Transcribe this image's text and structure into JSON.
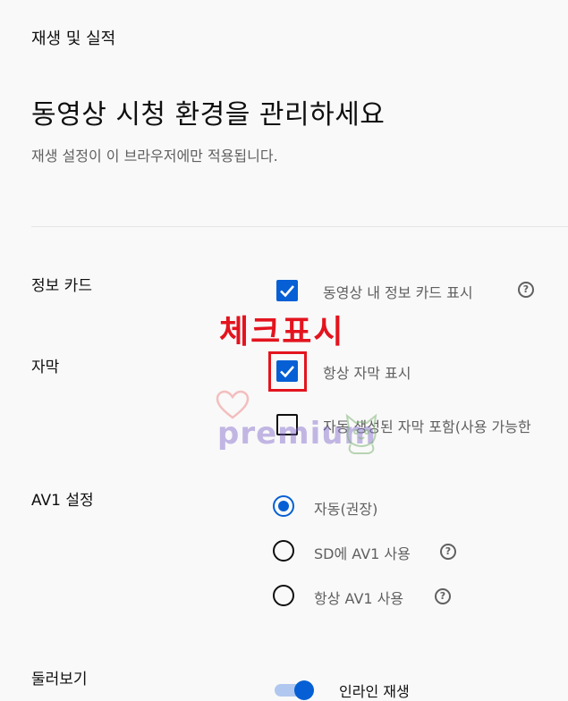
{
  "header": {
    "breadcrumb": "재생 및 실적",
    "title": "동영상 시청 환경을 관리하세요",
    "subtitle": "재생 설정이 이 브라우저에만 적용됩니다."
  },
  "sections": {
    "info_cards": {
      "label": "정보 카드",
      "option_label": "동영상 내 정보 카드 표시",
      "checked": true
    },
    "subtitles": {
      "label": "자막",
      "always_show_label": "항상 자막 표시",
      "always_show_checked": true,
      "auto_generated_label": "자동 생성된 자막 포함(사용 가능한",
      "auto_generated_checked": false
    },
    "av1": {
      "label": "AV1 설정",
      "options": [
        {
          "label": "자동(권장)",
          "selected": true
        },
        {
          "label": "SD에 AV1 사용",
          "selected": false
        },
        {
          "label": "항상 AV1 사용",
          "selected": false
        }
      ]
    },
    "browse": {
      "label": "둘러보기",
      "inline_play_label": "인라인 재생",
      "inline_play_on": true
    }
  },
  "annotation": {
    "text": "체크표시",
    "color": "#e3141e"
  },
  "watermark": {
    "text": "premium"
  },
  "colors": {
    "accent": "#065fd4",
    "secondary_text": "#606060"
  },
  "icons": {
    "help": "help-circle-icon",
    "check": "checkmark-icon",
    "heart": "heart-icon",
    "cat": "cat-icon"
  }
}
